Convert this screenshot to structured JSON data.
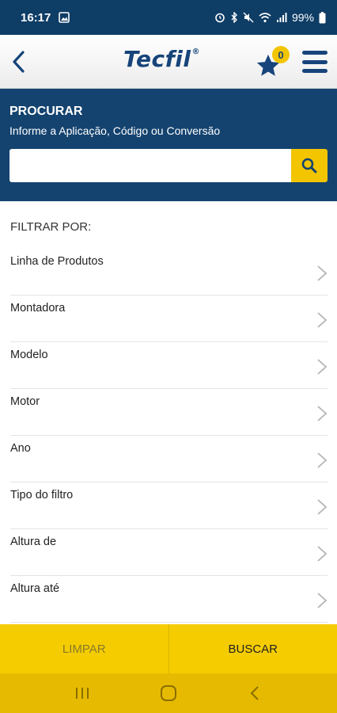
{
  "status_bar": {
    "time": "16:17",
    "battery": "99%"
  },
  "header": {
    "logo_text": "Tecfil",
    "logo_mark": "®",
    "favorites_count": "0",
    "colors": {
      "brand_blue": "#17447a",
      "accent_yellow": "#f2c500"
    }
  },
  "search": {
    "title": "PROCURAR",
    "subtitle": "Informe a Aplicação, Código ou Conversão",
    "value": "",
    "placeholder": ""
  },
  "filters": {
    "heading": "FILTRAR POR:",
    "items": [
      {
        "label": "Linha de Produtos"
      },
      {
        "label": "Montadora"
      },
      {
        "label": "Modelo"
      },
      {
        "label": "Motor"
      },
      {
        "label": "Ano"
      },
      {
        "label": "Tipo do filtro"
      },
      {
        "label": "Altura de"
      },
      {
        "label": "Altura até"
      }
    ]
  },
  "actions": {
    "clear_label": "LIMPAR",
    "search_label": "BUSCAR"
  }
}
